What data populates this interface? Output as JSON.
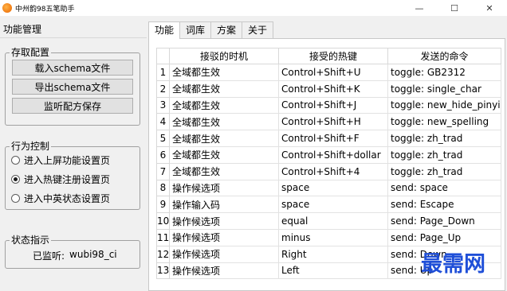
{
  "window": {
    "title": "中州韵98五笔助手",
    "controls": {
      "minimize": "—",
      "maximize": "☐",
      "close": "✕"
    }
  },
  "left_panel": {
    "title": "功能管理",
    "storage_group": {
      "legend": "存取配置",
      "buttons": [
        "载入schema文件",
        "导出schema文件",
        "监听配方保存"
      ]
    },
    "behavior_group": {
      "legend": "行为控制",
      "options": [
        {
          "label": "进入上屏功能设置页",
          "checked": false
        },
        {
          "label": "进入热键注册设置页",
          "checked": true
        },
        {
          "label": "进入中英状态设置页",
          "checked": false
        }
      ]
    },
    "status_group": {
      "legend": "状态指示",
      "label": "已监听:",
      "value": "wubi98_ci"
    }
  },
  "tabs": [
    {
      "label": "功能",
      "active": true
    },
    {
      "label": "词库",
      "active": false
    },
    {
      "label": "方案",
      "active": false
    },
    {
      "label": "关于",
      "active": false
    }
  ],
  "table": {
    "columns": [
      "接驳的时机",
      "接受的热键",
      "发送的命令"
    ],
    "rows": [
      {
        "idx": "1",
        "when": "全域都生效",
        "key": "Control+Shift+U",
        "cmd": "toggle: GB2312"
      },
      {
        "idx": "2",
        "when": "全域都生效",
        "key": "Control+Shift+K",
        "cmd": "toggle: single_char"
      },
      {
        "idx": "3",
        "when": "全域都生效",
        "key": "Control+Shift+J",
        "cmd": "toggle: new_hide_pinyin"
      },
      {
        "idx": "4",
        "when": "全域都生效",
        "key": "Control+Shift+H",
        "cmd": "toggle: new_spelling"
      },
      {
        "idx": "5",
        "when": "全域都生效",
        "key": "Control+Shift+F",
        "cmd": "toggle: zh_trad"
      },
      {
        "idx": "6",
        "when": "全域都生效",
        "key": "Control+Shift+dollar",
        "cmd": "toggle: zh_trad"
      },
      {
        "idx": "7",
        "when": "全域都生效",
        "key": "Control+Shift+4",
        "cmd": "toggle: zh_trad"
      },
      {
        "idx": "8",
        "when": "操作候选项",
        "key": "space",
        "cmd": "send: space"
      },
      {
        "idx": "9",
        "when": "操作输入码",
        "key": "space",
        "cmd": "send: Escape"
      },
      {
        "idx": "10",
        "when": "操作候选项",
        "key": "equal",
        "cmd": "send: Page_Down"
      },
      {
        "idx": "11",
        "when": "操作候选项",
        "key": "minus",
        "cmd": "send: Page_Up"
      },
      {
        "idx": "12",
        "when": "操作候选项",
        "key": "Right",
        "cmd": "send: Down"
      },
      {
        "idx": "13",
        "when": "操作候选项",
        "key": "Left",
        "cmd": "send: Up"
      }
    ]
  },
  "watermark": "最需网",
  "colors": {
    "accent": "#1f4fd8",
    "icon": "#f07a12"
  }
}
